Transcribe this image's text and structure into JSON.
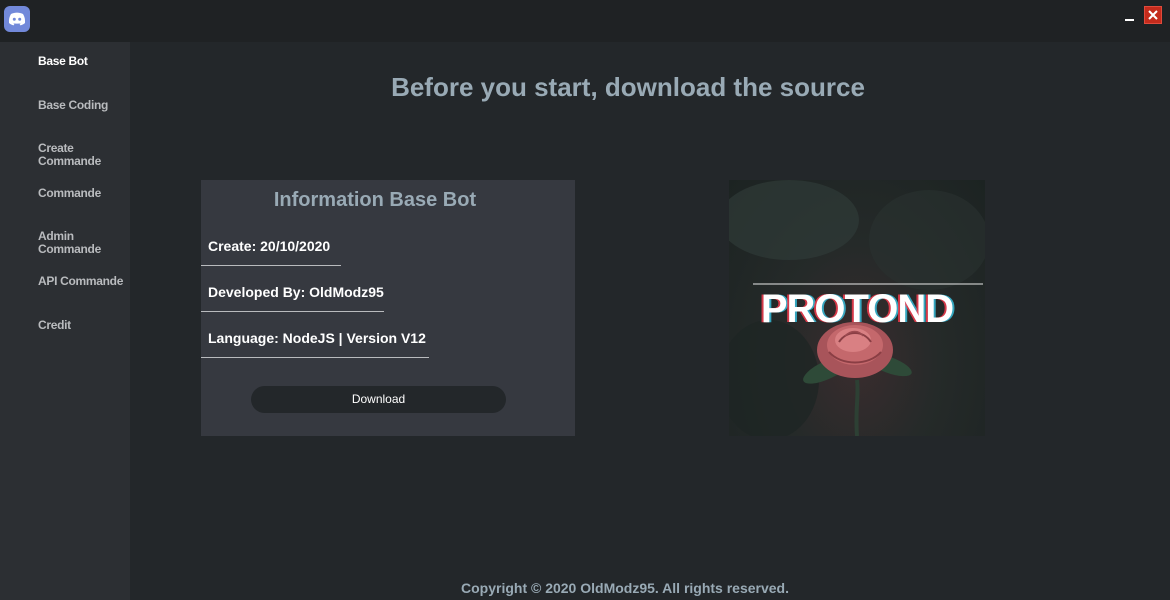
{
  "window": {
    "logo_icon": "discord-icon",
    "minimize_icon": "minimize-icon",
    "close_icon": "close-icon",
    "accent_color": "#7289da",
    "close_color": "#c42b1c"
  },
  "sidebar": {
    "items": [
      {
        "label": "Base Bot",
        "active": true
      },
      {
        "label": "Base Coding"
      },
      {
        "label": "Create Commande"
      },
      {
        "label": "Commande"
      },
      {
        "label": "Admin Commande"
      },
      {
        "label": "API Commande"
      },
      {
        "label": "Credit"
      }
    ]
  },
  "main": {
    "title": "Before you start, download the source"
  },
  "info": {
    "title": "Information Base Bot",
    "create": "Create: 20/10/2020",
    "developer": "Developed By: OldModz95",
    "language": "Language: NodeJS | Version V12",
    "download_label": "Download"
  },
  "cover": {
    "text": "PROTOND"
  },
  "footer": {
    "copyright": "Copyright © 2020 OldModz95. All rights reserved."
  }
}
